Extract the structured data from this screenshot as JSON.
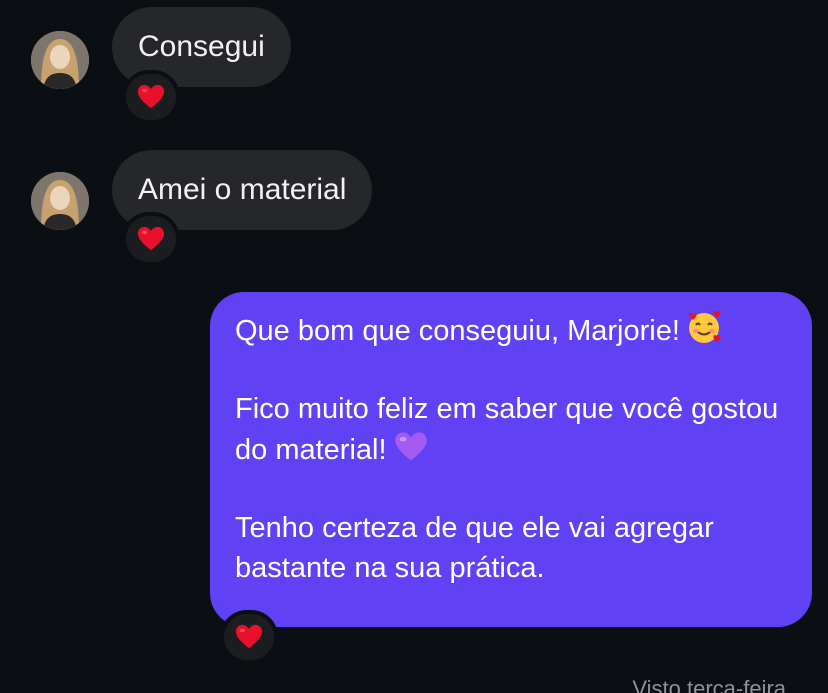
{
  "conversation": {
    "incoming": [
      {
        "sender": "Marjorie",
        "text": "Consegui",
        "reaction_icon": "red-heart-icon"
      },
      {
        "sender": "Marjorie",
        "text": "Amei o material",
        "reaction_icon": "red-heart-icon"
      }
    ],
    "outgoing": {
      "line1": "Que bom que conseguiu, Marjorie!",
      "line1_emoji": "smiling-face-with-hearts-icon",
      "line2": "Fico muito feliz em saber que você gostou do material!",
      "line2_emoji": "purple-heart-icon",
      "line3": "Tenho certeza de que ele vai agregar bastante na sua prática.",
      "reaction_icon": "red-heart-icon"
    },
    "seen_status": "Visto terça-feira"
  },
  "colors": {
    "background": "#0b0f13",
    "incoming_bubble": "#26272b",
    "outgoing_bubble": "#6041f3",
    "reaction_pill": "#1c1d21",
    "heart_red": "#e8102b",
    "heart_purple": "#a35bf0",
    "seen_text": "#8f9196"
  }
}
